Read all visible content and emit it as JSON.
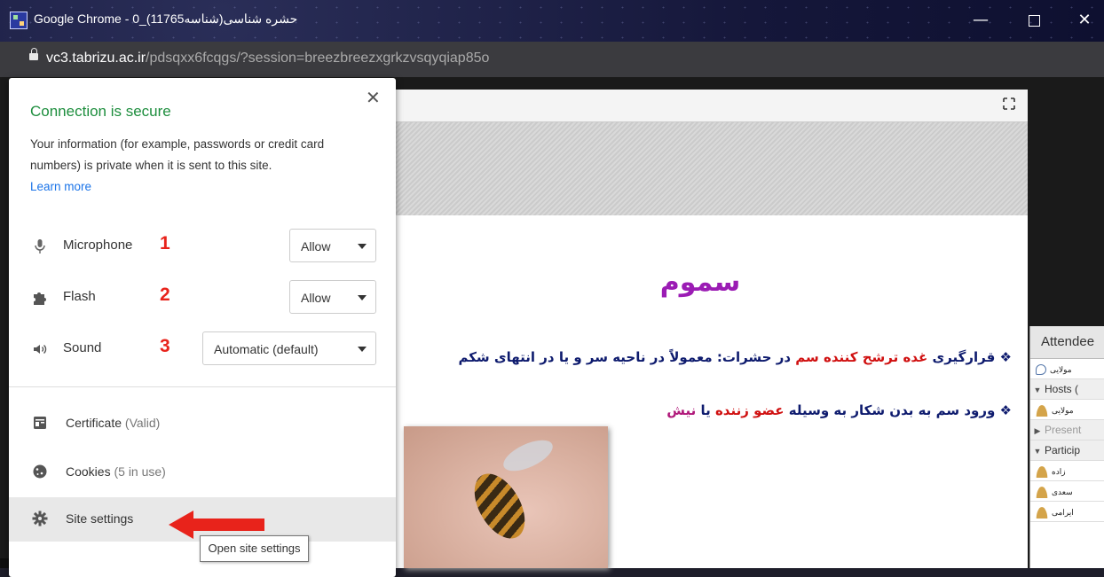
{
  "window": {
    "title": "Google Chrome - 0_(11765حشره شناسی(شناسه",
    "min_label": "—",
    "close_label": "✕"
  },
  "address_bar": {
    "host": "vc3.tabrizu.ac.ir",
    "path": "/pdsqxx6fcqgs/?session=breezbreezxgrkzvsqyqiap85o"
  },
  "slide": {
    "title": "سموم",
    "bullet1": {
      "marker": "❖",
      "part1": "قرارگیری",
      "part2": " غده ترشح کننده سم ",
      "part3": "در حشرات:  معمولاً در ناحیه سر و یا در انتهای شکم"
    },
    "bullet2": {
      "marker": "❖",
      "part1": "ورود سم به بدن شکار به وسیله ",
      "part2": "عضو زننده",
      "part3": " یا ",
      "part4": "نیش"
    }
  },
  "attendees": {
    "title": "Attendee",
    "rows": [
      {
        "text": "مولایی",
        "icon": "phone-icon"
      },
      {
        "text": "Hosts (",
        "type": "section",
        "icon": "triangle-down-icon"
      },
      {
        "text": "مولایی",
        "icon": "host-person-icon"
      },
      {
        "text": "Present",
        "type": "section",
        "icon": "triangle-right-icon"
      },
      {
        "text": "Particip",
        "type": "section",
        "icon": "triangle-down-icon"
      },
      {
        "text": "زاده",
        "icon": "participant-icon"
      },
      {
        "text": "سعدی",
        "icon": "participant-camera-icon"
      },
      {
        "text": "ایرامی",
        "icon": "participant-camera-icon"
      }
    ]
  },
  "site_info_popup": {
    "title": "Connection is secure",
    "info_text": "Your information (for example, passwords or credit card numbers) is private when it is sent to this site.",
    "learn_more": "Learn more",
    "close_label": "✕",
    "permissions": [
      {
        "label": "Microphone",
        "value": "Allow",
        "annotation": "1",
        "icon": "microphone-icon"
      },
      {
        "label": "Flash",
        "value": "Allow",
        "annotation": "2",
        "icon": "puzzle-icon"
      },
      {
        "label": "Sound",
        "value": "Automatic (default)",
        "annotation": "3",
        "icon": "speaker-icon"
      }
    ],
    "items": [
      {
        "label": "Certificate",
        "sub": " (Valid)",
        "icon": "certificate-icon"
      },
      {
        "label": "Cookies",
        "sub": " (5 in use)",
        "icon": "cookie-icon"
      },
      {
        "label": "Site settings",
        "sub": "",
        "icon": "gear-icon"
      }
    ],
    "tooltip": "Open site settings"
  },
  "colors": {
    "secure_green": "#1e8e3e",
    "link_blue": "#1a73e8",
    "annotation_red": "#e8231b",
    "slide_title_purple": "#9b1cb4"
  }
}
